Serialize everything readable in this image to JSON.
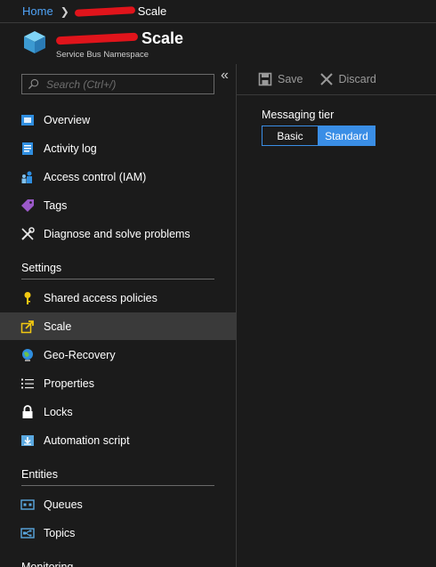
{
  "breadcrumb": {
    "home": "Home",
    "current": "Scale"
  },
  "resource": {
    "title": "Scale",
    "subtitle": "Service Bus Namespace"
  },
  "search": {
    "placeholder": "Search (Ctrl+/)"
  },
  "nav": {
    "overview": "Overview",
    "activity_log": "Activity log",
    "access_control": "Access control (IAM)",
    "tags": "Tags",
    "diagnose": "Diagnose and solve problems",
    "settings_header": "Settings",
    "shared_access": "Shared access policies",
    "scale": "Scale",
    "geo_recovery": "Geo-Recovery",
    "properties": "Properties",
    "locks": "Locks",
    "automation": "Automation script",
    "entities_header": "Entities",
    "queues": "Queues",
    "topics": "Topics",
    "monitoring_header": "Monitoring"
  },
  "toolbar": {
    "save_label": "Save",
    "discard_label": "Discard"
  },
  "main": {
    "tier_label": "Messaging tier",
    "tier_options": [
      "Basic",
      "Standard"
    ],
    "selected_tier": "Standard"
  },
  "colors": {
    "accent": "#3a8ee6",
    "link": "#4fa3f7",
    "background": "#1b1b1b",
    "active_row": "#3a3a3a",
    "redaction": "#e0141b"
  }
}
